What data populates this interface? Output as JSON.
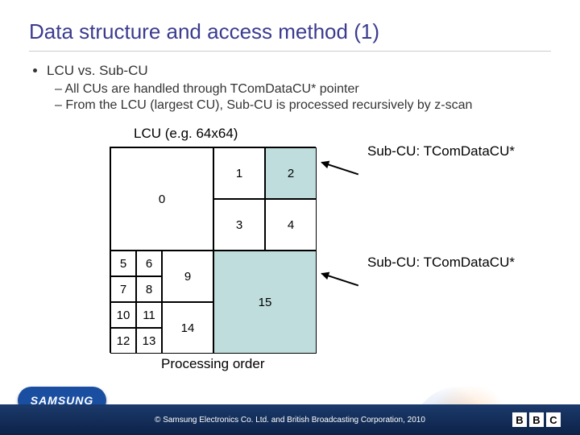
{
  "title": "Data structure and access method (1)",
  "bullet_main": "LCU vs. Sub-CU",
  "bullets_sub": [
    "All CUs are handled through TComDataCU* pointer",
    "From the LCU (largest CU), Sub-CU is processed recursively by z-scan"
  ],
  "diagram": {
    "lcu_label": "LCU (e.g. 64x64)",
    "processing_label": "Processing order",
    "annot1": "Sub-CU: TComDataCU*",
    "annot2": "Sub-CU: TComDataCU*",
    "cells": {
      "c0": "0",
      "c1": "1",
      "c2": "2",
      "c3": "3",
      "c4": "4",
      "c5": "5",
      "c6": "6",
      "c7": "7",
      "c8": "8",
      "c9": "9",
      "c10": "10",
      "c11": "11",
      "c12": "12",
      "c13": "13",
      "c14": "14",
      "c15": "15"
    }
  },
  "footer": {
    "samsung": "SAMSUNG",
    "copyright": "© Samsung Electronics Co. Ltd. and British Broadcasting Corporation, 2010",
    "bbc": [
      "B",
      "B",
      "C"
    ]
  }
}
